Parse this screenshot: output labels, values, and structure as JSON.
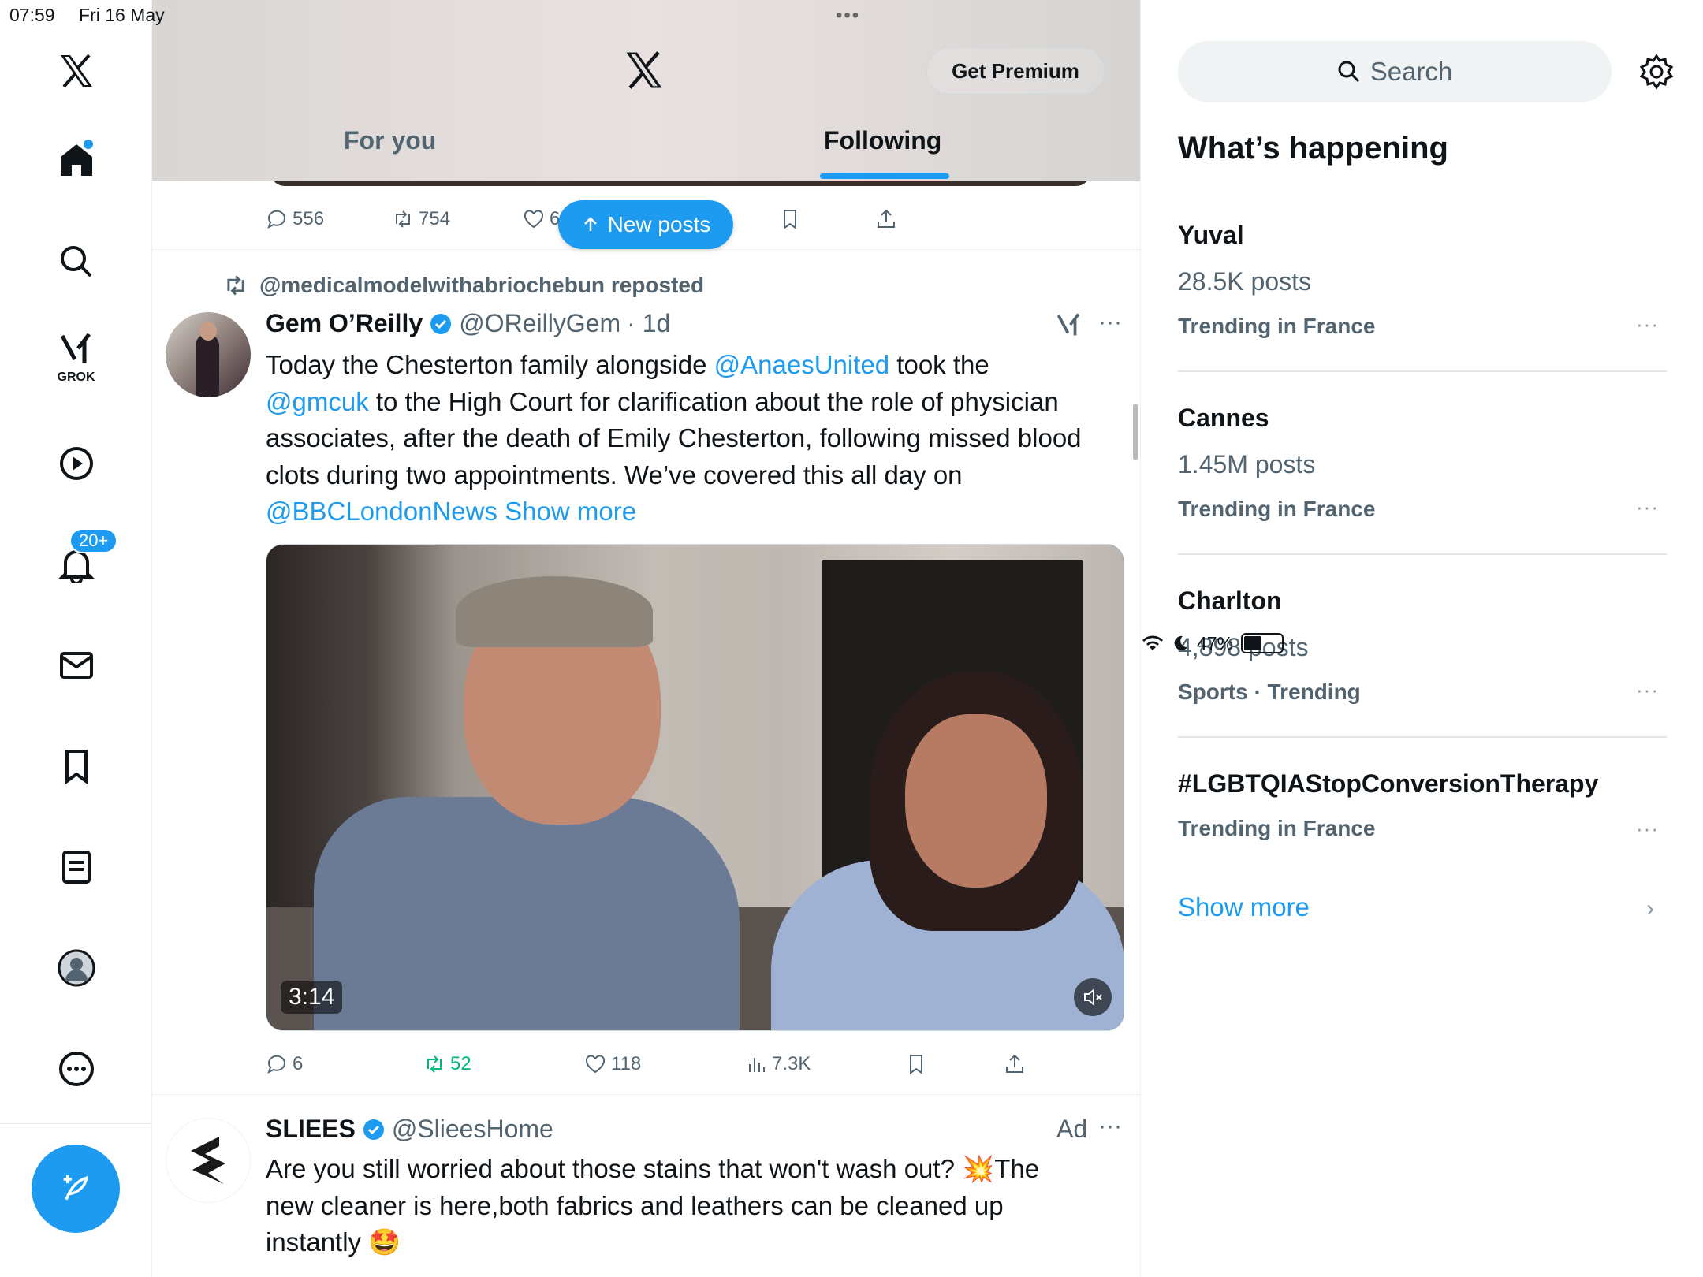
{
  "status": {
    "time": "07:59",
    "date": "Fri 16 May",
    "battery": "47%",
    "battery_level": 0.47,
    "center_dots": "•••"
  },
  "nav": {
    "grok_label": "GROK",
    "notifications_badge": "20+"
  },
  "header": {
    "premium_label": "Get Premium",
    "tabs": [
      {
        "label": "For you",
        "active": false
      },
      {
        "label": "Following",
        "active": true
      }
    ]
  },
  "prev_post": {
    "replies": "556",
    "reposts": "754",
    "likes": "6"
  },
  "new_posts_label": "New posts",
  "post": {
    "repost_text": "@medicalmodelwithabriochebun reposted",
    "name": "Gem O’Reilly",
    "handle": "@OReillyGem",
    "time": "· 1d",
    "body": {
      "t1": "Today the Chesterton family alongside ",
      "m1": "@AnaesUnited",
      "t2": " took the ",
      "m2": "@gmcuk",
      "t3": " to the High Court for clarification about the role of physician associates, after the death of Emily Chesterton, following missed blood clots during two appointments. We’ve covered this all day on ",
      "m3": "@BBCLondonNews",
      "show_more": " Show more"
    },
    "video_duration": "3:14",
    "replies": "6",
    "reposts": "52",
    "likes": "118",
    "views": "7.3K"
  },
  "ad": {
    "name": "SLIEES",
    "handle": "@SlieesHome",
    "label": "Ad",
    "more": "···",
    "body": "Are you still worried about those stains that won't wash out? 💥The new  cleaner is here,both fabrics and leathers can be cleaned up instantly 🤩"
  },
  "sidebar": {
    "search_placeholder": "Search",
    "title": "What’s happening",
    "trends": [
      {
        "name": "Yuval",
        "count": "28.5K posts",
        "meta": "Trending in France"
      },
      {
        "name": "Cannes",
        "count": "1.45M posts",
        "meta": "Trending in France"
      },
      {
        "name": "Charlton",
        "count": "4,898 posts",
        "meta": "Sports · Trending"
      },
      {
        "name": "#LGBTQIAStopConversionTherapy",
        "count": "",
        "meta": "Trending in France"
      }
    ],
    "more_dots": "···",
    "show_more": "Show more",
    "chevron": "›"
  },
  "colors": {
    "accent": "#1d9bf0",
    "repost_green": "#00ba7c",
    "text": "#0f1419",
    "muted": "#536471"
  }
}
